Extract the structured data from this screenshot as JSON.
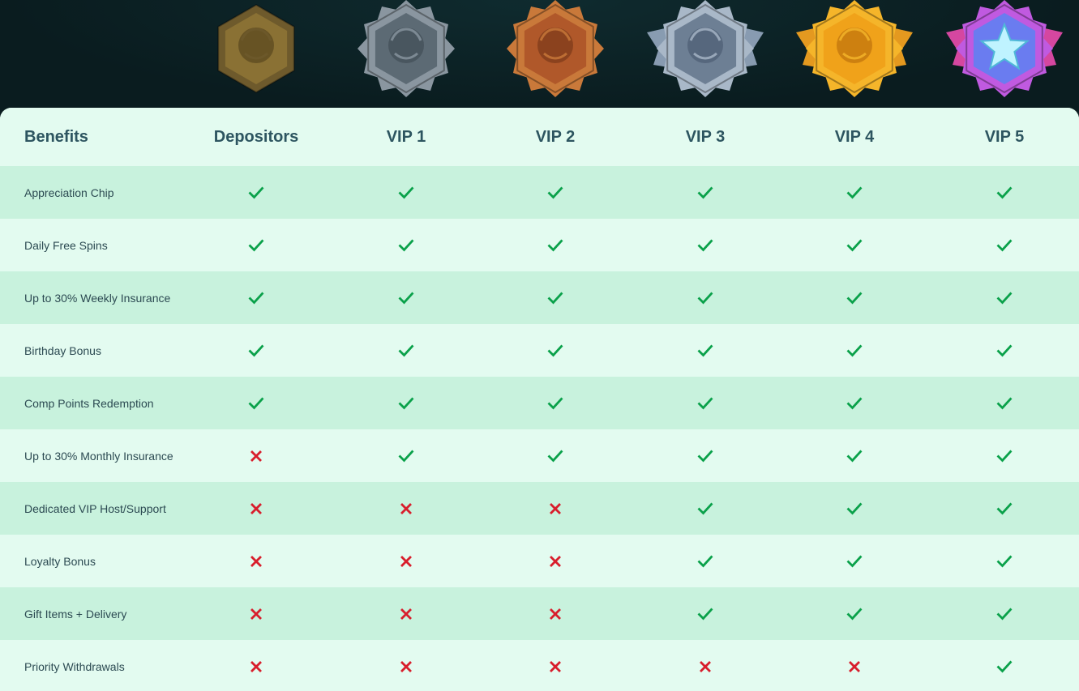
{
  "tiers": [
    {
      "name": "Depositors",
      "badge": "bronze-hex-medusa-badge"
    },
    {
      "name": "VIP 1",
      "badge": "silver-hex-medusa-badge"
    },
    {
      "name": "VIP 2",
      "badge": "copper-spiked-medusa-badge"
    },
    {
      "name": "VIP 3",
      "badge": "steel-winged-medusa-badge"
    },
    {
      "name": "VIP 4",
      "badge": "gold-winged-medusa-badge"
    },
    {
      "name": "VIP 5",
      "badge": "rainbow-winged-star-badge"
    }
  ],
  "benefits_header": "Benefits",
  "benefits": [
    {
      "label": "Appreciation Chip",
      "availability": [
        true,
        true,
        true,
        true,
        true,
        true
      ]
    },
    {
      "label": "Daily Free Spins",
      "availability": [
        true,
        true,
        true,
        true,
        true,
        true
      ]
    },
    {
      "label": "Up to 30% Weekly Insurance",
      "availability": [
        true,
        true,
        true,
        true,
        true,
        true
      ]
    },
    {
      "label": "Birthday Bonus",
      "availability": [
        true,
        true,
        true,
        true,
        true,
        true
      ]
    },
    {
      "label": "Comp Points Redemption",
      "availability": [
        true,
        true,
        true,
        true,
        true,
        true
      ]
    },
    {
      "label": "Up to 30% Monthly Insurance",
      "availability": [
        false,
        true,
        true,
        true,
        true,
        true
      ]
    },
    {
      "label": "Dedicated VIP Host/Support",
      "availability": [
        false,
        false,
        false,
        true,
        true,
        true
      ]
    },
    {
      "label": "Loyalty Bonus",
      "availability": [
        false,
        false,
        false,
        true,
        true,
        true
      ]
    },
    {
      "label": "Gift Items + Delivery",
      "availability": [
        false,
        false,
        false,
        true,
        true,
        true
      ]
    },
    {
      "label": "Priority Withdrawals",
      "availability": [
        false,
        false,
        false,
        false,
        false,
        true
      ]
    }
  ],
  "colors": {
    "check": "#0aa14a",
    "cross": "#d81e2c",
    "header_text": "#2d5560",
    "row_shade": "#c8f2dd",
    "row_light": "#e3fbf0",
    "top_background": "#0b1d21"
  }
}
